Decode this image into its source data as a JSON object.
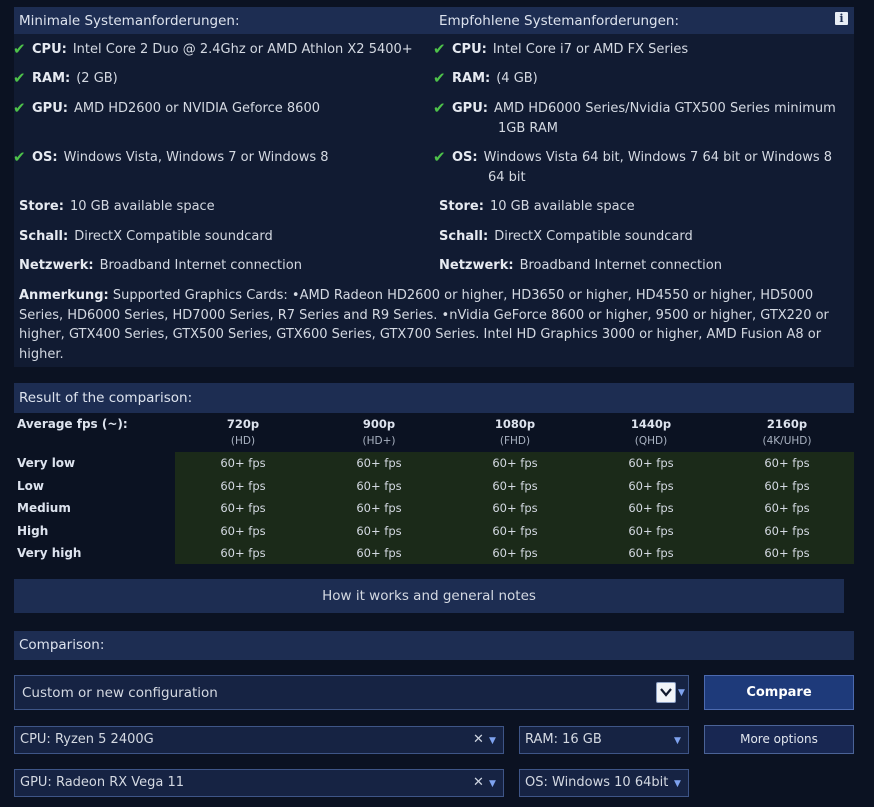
{
  "requirements": {
    "minimum": {
      "header": "Minimale Systemanforderungen:",
      "cpu": {
        "label": "CPU:",
        "value": "Intel Core 2 Duo @ 2.4Ghz or AMD Athlon X2 5400+"
      },
      "ram": {
        "label": "RAM:",
        "value": "(2 GB)"
      },
      "gpu": {
        "label": "GPU:",
        "value": "AMD HD2600 or NVIDIA Geforce 8600"
      },
      "os": {
        "label": "OS:",
        "value": "Windows Vista, Windows 7 or Windows 8"
      },
      "store": {
        "label": "Store:",
        "value": "10 GB available space"
      },
      "sound": {
        "label": "Schall:",
        "value": "DirectX Compatible soundcard"
      },
      "network": {
        "label": "Netzwerk:",
        "value": "Broadband Internet connection"
      }
    },
    "recommended": {
      "header": "Empfohlene Systemanforderungen:",
      "cpu": {
        "label": "CPU:",
        "value": "Intel Core i7 or AMD FX Series"
      },
      "ram": {
        "label": "RAM:",
        "value": "(4 GB)"
      },
      "gpu": {
        "label": "GPU:",
        "value_line1": "AMD HD6000 Series/Nvidia GTX500 Series minimum",
        "value_line2": "1GB RAM"
      },
      "os": {
        "label": "OS:",
        "value_line1": "Windows Vista 64 bit, Windows 7 64 bit or Windows 8",
        "value_line2": "64 bit"
      },
      "store": {
        "label": "Store:",
        "value": "10 GB available space"
      },
      "sound": {
        "label": "Schall:",
        "value": "DirectX Compatible soundcard"
      },
      "network": {
        "label": "Netzwerk:",
        "value": "Broadband Internet connection"
      }
    },
    "note": {
      "label": "Anmerkung:",
      "text": "Supported Graphics Cards: •AMD Radeon HD2600 or higher, HD3650 or higher, HD4550 or higher, HD5000 Series, HD6000 Series, HD7000 Series, R7 Series and R9 Series. •nVidia GeForce 8600 or higher, 9500 or higher, GTX220 or higher, GTX400 Series, GTX500 Series, GTX600 Series, GTX700 Series. Intel HD Graphics 3000 or higher, AMD Fusion A8 or higher."
    }
  },
  "result": {
    "title": "Result of the comparison:",
    "fps_label": "Average fps (~):",
    "resolutions": [
      {
        "name": "720p",
        "sub": "(HD)"
      },
      {
        "name": "900p",
        "sub": "(HD+)"
      },
      {
        "name": "1080p",
        "sub": "(FHD)"
      },
      {
        "name": "1440p",
        "sub": "(QHD)"
      },
      {
        "name": "2160p",
        "sub": "(4K/UHD)"
      }
    ],
    "rows": [
      {
        "label": "Very low",
        "values": [
          "60+ fps",
          "60+ fps",
          "60+ fps",
          "60+ fps",
          "60+ fps"
        ]
      },
      {
        "label": "Low",
        "values": [
          "60+ fps",
          "60+ fps",
          "60+ fps",
          "60+ fps",
          "60+ fps"
        ]
      },
      {
        "label": "Medium",
        "values": [
          "60+ fps",
          "60+ fps",
          "60+ fps",
          "60+ fps",
          "60+ fps"
        ]
      },
      {
        "label": "High",
        "values": [
          "60+ fps",
          "60+ fps",
          "60+ fps",
          "60+ fps",
          "60+ fps"
        ]
      },
      {
        "label": "Very high",
        "values": [
          "60+ fps",
          "60+ fps",
          "60+ fps",
          "60+ fps",
          "60+ fps"
        ]
      }
    ]
  },
  "how_it_works": "How it works and general notes",
  "comparison": {
    "title": "Comparison:",
    "config_select": "Custom or new configuration",
    "compare_button": "Compare",
    "more_options": "More options",
    "cpu_select": "CPU: Ryzen 5 2400G",
    "ram_select": "RAM: 16 GB",
    "gpu_select": "GPU: Radeon RX Vega 11",
    "os_select": "OS: Windows 10 64bit"
  },
  "colors": {
    "background": "#0b1222",
    "header_bar": "#1d2d52",
    "check_green": "#4ec24a",
    "fps_cell_bg": "#1b2a19",
    "compare_button": "#1e3a7a"
  },
  "icons": {
    "info": "info-icon",
    "check": "check-icon",
    "dropdown": "chevron-down-icon",
    "clear": "clear-x-icon"
  }
}
